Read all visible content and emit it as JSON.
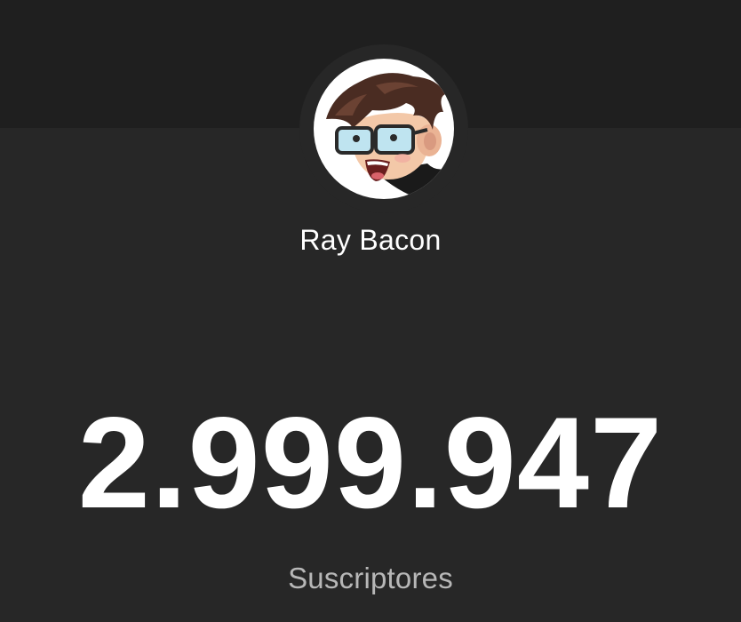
{
  "channel": {
    "name": "Ray Bacon",
    "avatar_icon": "cartoon-avatar-glasses"
  },
  "stats": {
    "subscriber_count": "2.999.947",
    "subscriber_label": "Suscriptores"
  },
  "colors": {
    "background": "#272727",
    "top_band": "#1f1f1f",
    "count_text": "#ffffff",
    "label_text": "#b7b7b7"
  }
}
